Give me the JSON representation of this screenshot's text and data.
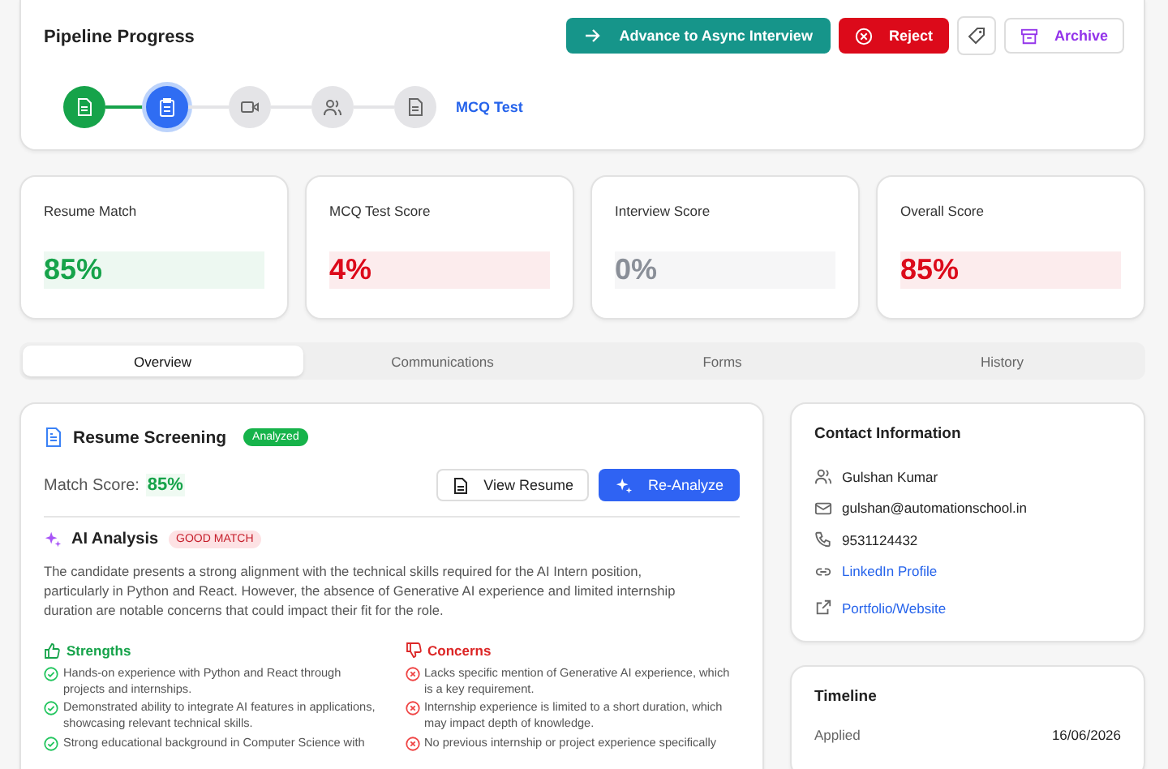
{
  "header": {
    "title": "Pipeline Progress",
    "actions": [
      {
        "kind": "advance",
        "label": "Advance to Async Interview"
      },
      {
        "kind": "reject",
        "label": "Reject"
      },
      {
        "kind": "tag"
      },
      {
        "kind": "archive",
        "label": "Archive"
      }
    ]
  },
  "pipeline": {
    "current_label": "MCQ Test",
    "steps": [
      {
        "kind": "document",
        "completed": true,
        "selected": false
      },
      {
        "kind": "clipboard",
        "completed": false,
        "selected": true
      },
      {
        "kind": "video",
        "completed": false,
        "selected": false
      },
      {
        "kind": "people",
        "completed": false,
        "selected": false
      },
      {
        "kind": "file",
        "completed": false,
        "selected": false
      }
    ]
  },
  "scores": [
    {
      "label": "Resume Match",
      "value": "85%",
      "color": "#16a34a"
    },
    {
      "label": "MCQ Test Score",
      "value": "4%",
      "color": "#dc0a1a"
    },
    {
      "label": "Interview Score",
      "value": "0%",
      "color": "#8a8f98"
    },
    {
      "label": "Overall Score",
      "value": "85%",
      "color": "#dc0a1a"
    }
  ],
  "tabs": [
    {
      "label": "Overview",
      "selected": true
    },
    {
      "label": "Communications",
      "selected": false
    },
    {
      "label": "Forms",
      "selected": false
    },
    {
      "label": "History",
      "selected": false
    }
  ],
  "screening": {
    "title": "Resume Screening",
    "badge": "Analyzed",
    "match_label": "Match Score:",
    "match_value": "85%",
    "buttons": [
      {
        "kind": "secondary",
        "label": "View Resume"
      },
      {
        "kind": "primary",
        "label": "Re-Analyze"
      }
    ],
    "analysis_title": "AI Analysis",
    "analysis_badge": "GOOD MATCH",
    "summary": "The candidate presents a strong alignment with the technical skills required for the AI Intern position, particularly in Python and React. However, the absence of Generative AI experience and limited internship duration are notable concerns that could impact their fit for the role.",
    "lists": [
      {
        "kind": "strengths",
        "title": "Strengths",
        "items": [
          "Hands-on experience with Python and React through projects and internships.",
          "Demonstrated ability to integrate AI features in applications, showcasing relevant technical skills.",
          "Strong educational background in Computer Science with"
        ]
      },
      {
        "kind": "concerns",
        "title": "Concerns",
        "items": [
          "Lacks specific mention of Generative AI experience, which is a key requirement.",
          "Internship experience is limited to a short duration, which may impact depth of knowledge.",
          "No previous internship or project experience specifically"
        ]
      }
    ]
  },
  "contact": {
    "title": "Contact Information",
    "items": [
      {
        "kind": "person",
        "text": "Gulshan Kumar",
        "link": false
      },
      {
        "kind": "mail",
        "text": "gulshan@automationschool.in",
        "link": false
      },
      {
        "kind": "phone",
        "text": "9531124432",
        "link": false
      },
      {
        "kind": "chain",
        "text": "LinkedIn Profile",
        "link": true
      },
      {
        "kind": "external",
        "text": "Portfolio/Website",
        "link": true
      }
    ]
  },
  "timeline": {
    "title": "Timeline",
    "rows": [
      {
        "label": "Applied",
        "value": "16/06/2026"
      }
    ]
  }
}
